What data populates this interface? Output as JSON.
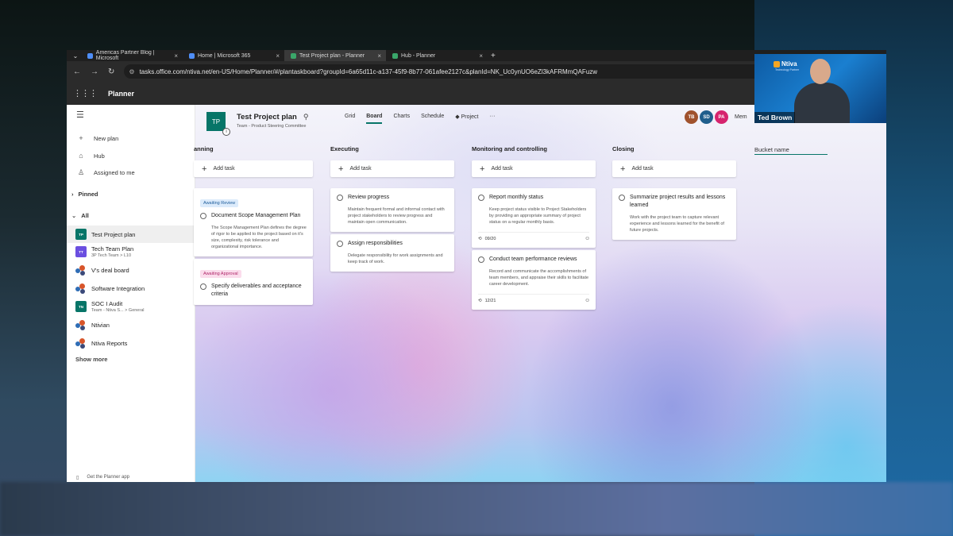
{
  "browser": {
    "tabs": [
      {
        "label": "Americas Partner Blog | Microsoft",
        "fav": "blue"
      },
      {
        "label": "Home | Microsoft 365",
        "fav": "blue"
      },
      {
        "label": "Test Project plan - Planner",
        "fav": "green",
        "active": true
      },
      {
        "label": "Hub - Planner",
        "fav": "green"
      }
    ],
    "url": "tasks.office.com/ntiva.net/en-US/Home/Planner/#/plantaskboard?groupId=6a65d11c-a137-45f9-8b77-061afee2127c&planId=NK_Uc0ynUO6eZl3kAFRMmQAFuzw"
  },
  "app": {
    "title": "Planner"
  },
  "sidebar": {
    "nav": [
      {
        "label": "New plan",
        "icon": "plus-icon"
      },
      {
        "label": "Hub",
        "icon": "home-icon"
      },
      {
        "label": "Assigned to me",
        "icon": "person-icon"
      }
    ],
    "pinned_label": "Pinned",
    "all_label": "All",
    "plans": [
      {
        "name": "Test Project plan",
        "sub": "",
        "badge": "TP",
        "color": "#077568"
      },
      {
        "name": "Tech Team Plan",
        "sub": "3P Tech Team  >  L10",
        "badge": "TT",
        "color": "#6b4fe0"
      },
      {
        "name": "V's deal board",
        "sub": "",
        "badge": "",
        "color": ""
      },
      {
        "name": "Software Integration",
        "sub": "",
        "badge": "",
        "color": ""
      },
      {
        "name": "SOC I Audit",
        "sub": "Team - Ntiva S...  >  General",
        "badge": "TN",
        "color": "#077568"
      },
      {
        "name": "Ntivian",
        "sub": "",
        "badge": "",
        "color": ""
      },
      {
        "name": "Ntiva Reports",
        "sub": "",
        "badge": "",
        "color": ""
      }
    ],
    "show_more": "Show more",
    "get_app": "Get the Planner app"
  },
  "plan": {
    "initials": "TP",
    "title": "Test Project plan",
    "subtitle": "Team - Product Steering Committee",
    "views": [
      "Grid",
      "Board",
      "Charts",
      "Schedule",
      "Project",
      "···"
    ],
    "active_view": "Board",
    "members": [
      {
        "initials": "TB",
        "color": "#a0522d"
      },
      {
        "initials": "SD",
        "color": "#1f5e8c"
      },
      {
        "initials": "PA",
        "color": "#d6246e"
      }
    ],
    "members_label": "Mem"
  },
  "buckets": [
    {
      "title": "anning",
      "add_task": "Add task",
      "cards": [
        {
          "label": "Awaiting Review",
          "label_bg": "#dcebfb",
          "label_fg": "#1f5e9c",
          "title": "Document Scope Management Plan",
          "desc": "The Scope Management Plan defines the degree of rigor to be applied to the project based on it's size, complexity, risk tolerance and organizational importance."
        },
        {
          "label": "Awaiting Approval",
          "label_bg": "#fbdcec",
          "label_fg": "#b0296a",
          "title": "Specify deliverables and acceptance criteria",
          "desc": ""
        }
      ]
    },
    {
      "title": "Executing",
      "add_task": "Add task",
      "cards": [
        {
          "title": "Review progress",
          "desc": "Maintain frequent formal and informal contact with project stakeholders to review progress and maintain open communication."
        },
        {
          "title": "Assign responsibilities",
          "desc": "Delegate responsibility for work assignments and keep track of work."
        }
      ]
    },
    {
      "title": "Monitoring and controlling",
      "add_task": "Add task",
      "cards": [
        {
          "title": "Report monthly status",
          "desc": "Keep project status visible to Project Stakeholders by providing an appropriate summary of project status on a regular monthly basis.",
          "checklist": "09/20"
        },
        {
          "title": "Conduct team performance reviews",
          "desc": "Record and communicate the accomplishments of team members, and appraise their skills to facilitate career development.",
          "checklist": "12/21"
        }
      ]
    },
    {
      "title": "Closing",
      "add_task": "Add task",
      "cards": [
        {
          "title": "Summarize project results and lessons learned",
          "desc": "Work with the project team to capture relevant experience and lessons learned for the benefit of future projects."
        }
      ]
    }
  ],
  "new_bucket": {
    "value": "Bucket name"
  },
  "webcam": {
    "name": "Ted Brown",
    "logo": "Ntiva",
    "tagline": "Technology Partner"
  }
}
